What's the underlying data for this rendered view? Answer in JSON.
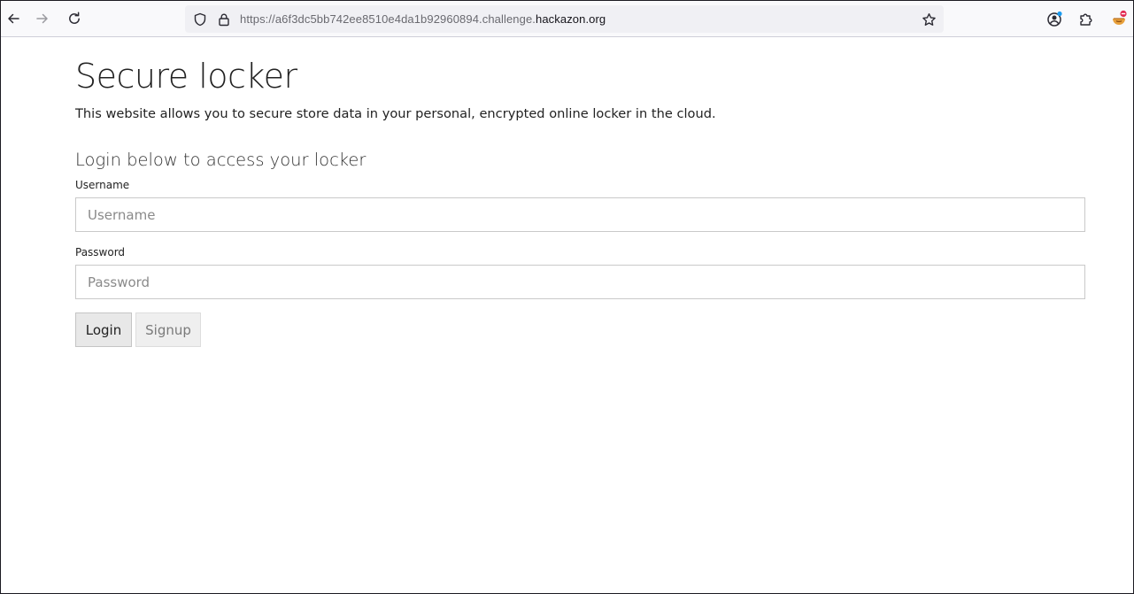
{
  "browser": {
    "url_prefix": "https://a6f3dc5bb742ee8510e4da1b92960894.challenge.",
    "url_host": "hackazon.org",
    "icons": {
      "back": "back-arrow-icon",
      "forward": "forward-arrow-icon",
      "reload": "reload-icon",
      "shield": "tracking-protection-shield-icon",
      "lock": "lock-icon",
      "bookmark": "star-icon",
      "account": "account-icon",
      "extensions": "puzzle-icon",
      "addon": "addon-icon"
    },
    "colors": {
      "toolbar": "#f9f9fb",
      "urlbar": "#f0f0f4",
      "account_dot": "#1a9bf0",
      "addon_badge": "#e22850"
    }
  },
  "page": {
    "title": "Secure locker",
    "subtitle": "This website allows you to secure store data in your personal, encrypted online locker in the cloud.",
    "section_title": "Login below to access your locker"
  },
  "form": {
    "username_label": "Username",
    "username_placeholder": "Username",
    "username_value": "",
    "password_label": "Password",
    "password_placeholder": "Password",
    "password_value": "",
    "login_label": "Login",
    "signup_label": "Signup"
  }
}
